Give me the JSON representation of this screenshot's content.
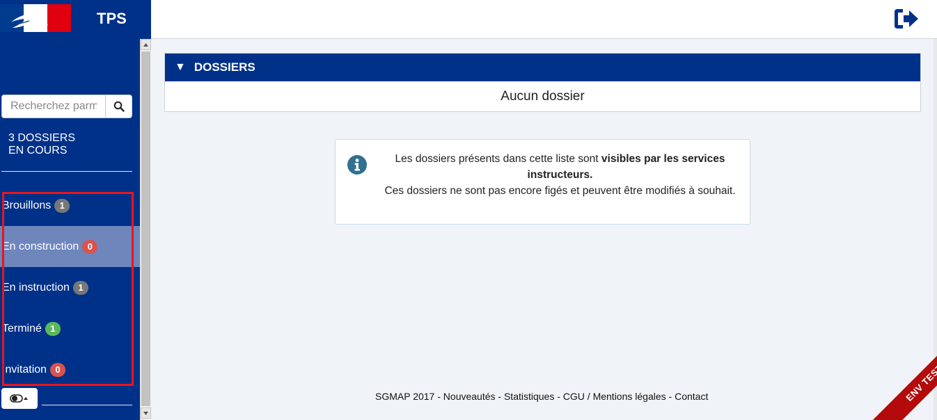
{
  "header": {
    "app_title": "TPS",
    "logout_icon": "sign-out-icon"
  },
  "sidebar": {
    "search": {
      "placeholder": "Recherchez parmi vos dossiers",
      "value": ""
    },
    "count_title": "3 DOSSIERS\nEN COURS",
    "items": [
      {
        "label": "Brouillons",
        "count": "1",
        "badge_color": "#777777",
        "active": false
      },
      {
        "label": "En construction",
        "count": "0",
        "badge_color": "#d9534f",
        "active": true
      },
      {
        "label": "En instruction",
        "count": "1",
        "badge_color": "#777777",
        "active": false
      },
      {
        "label": "Terminé",
        "count": "1",
        "badge_color": "#5cb85c",
        "active": false
      },
      {
        "label": "Invitation",
        "count": "0",
        "badge_color": "#d9534f",
        "active": false
      }
    ]
  },
  "main": {
    "panel_title": "DOSSIERS",
    "panel_empty": "Aucun dossier",
    "info": {
      "line1_prefix": "Les dossiers présents dans cette liste sont ",
      "line1_bold": "visibles par les services instructeurs.",
      "line2": "Ces dossiers ne sont pas encore figés et peuvent être modifiés à souhait."
    }
  },
  "footer": {
    "prefix": "SGMAP 2017 - ",
    "links": [
      "Nouveautés",
      "Statistiques",
      "CGU / Mentions légales",
      "Contact"
    ],
    "separator": " - "
  },
  "env_banner": "ENV TEST",
  "colors": {
    "primary": "#003189",
    "active_item": "#6f86bd",
    "info_icon": "#31708f",
    "env_banner": "#b30b0b"
  }
}
